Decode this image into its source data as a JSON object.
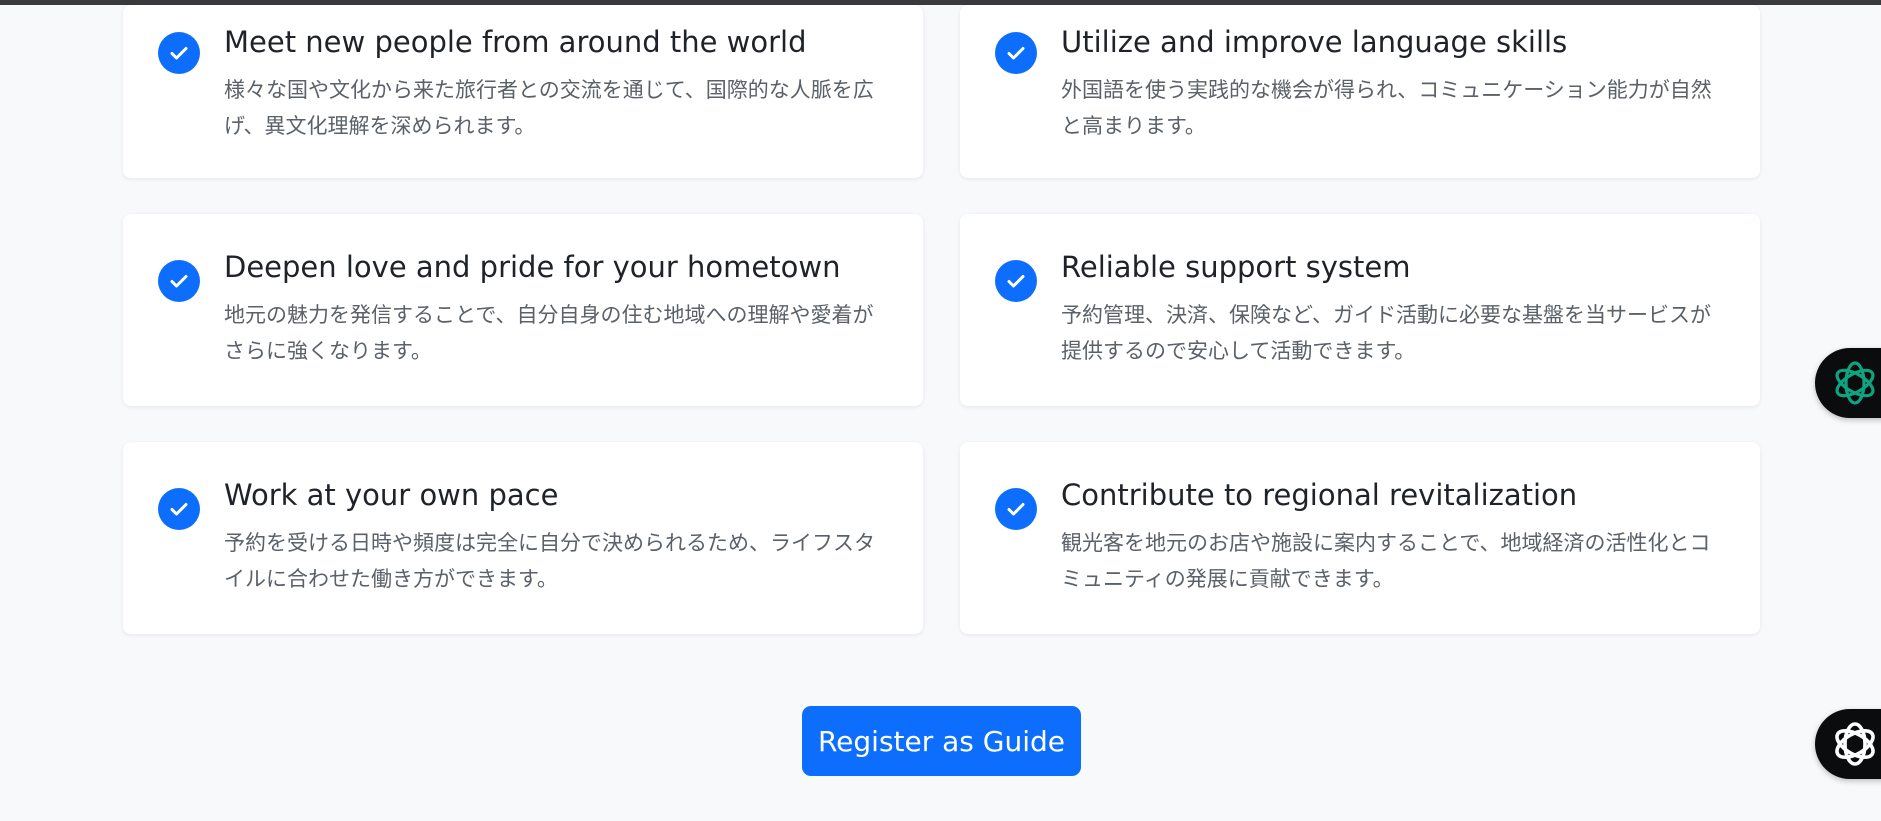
{
  "benefits": [
    {
      "title": "Meet new people from around the world",
      "desc": "様々な国や文化から来た旅行者との交流を通じて、国際的な人脈を広げ、異文化理解を深められます。",
      "icon": "check-circle-icon"
    },
    {
      "title": "Utilize and improve language skills",
      "desc": "外国語を使う実践的な機会が得られ、コミュニケーション能力が自然と高まります。",
      "icon": "check-circle-icon"
    },
    {
      "title": "Deepen love and pride for your hometown",
      "desc": "地元の魅力を発信することで、自分自身の住む地域への理解や愛着がさらに強くなります。",
      "icon": "check-circle-icon"
    },
    {
      "title": "Reliable support system",
      "desc": "予約管理、決済、保険など、ガイド活動に必要な基盤を当サービスが提供するので安心して活動できます。",
      "icon": "check-circle-icon"
    },
    {
      "title": "Work at your own pace",
      "desc": "予約を受ける日時や頻度は完全に自分で決められるため、ライフスタイルに合わせた働き方ができます。",
      "icon": "check-circle-icon"
    },
    {
      "title": "Contribute to regional revitalization",
      "desc": "観光客を地元のお店や施設に案内することで、地域経済の活性化とコミュニティの発展に貢献できます。",
      "icon": "check-circle-icon"
    }
  ],
  "cta": {
    "register_label": "Register as Guide"
  },
  "floating": {
    "assistant_icon": "chatgpt-logo-icon",
    "secondary_icon": "openai-logo-icon"
  },
  "colors": {
    "accent": "#0d6efd",
    "background": "#f8f9fb",
    "card": "#ffffff",
    "title_text": "#1f2328",
    "desc_text": "#5b6168",
    "assistant_green": "#10a37f"
  }
}
